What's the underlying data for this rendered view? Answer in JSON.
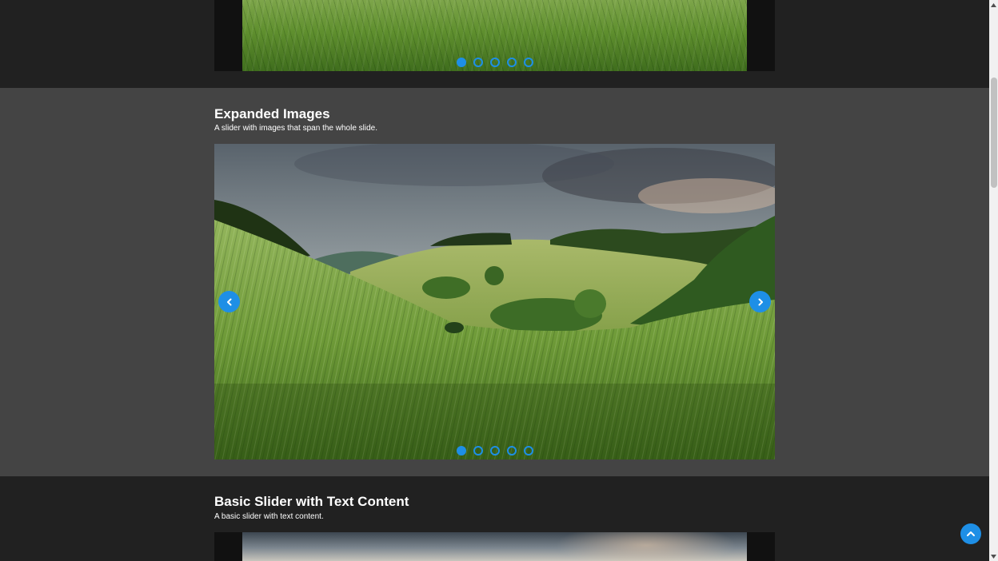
{
  "sections": [
    {
      "id": "previous-slider",
      "active_dot": 0,
      "dot_count": 5
    },
    {
      "id": "expanded-images",
      "title": "Expanded Images",
      "subtitle": "A slider with images that span the whole slide.",
      "active_dot": 0,
      "dot_count": 5,
      "prev_icon": "chevron-left-icon",
      "next_icon": "chevron-right-icon"
    },
    {
      "id": "basic-slider-text",
      "title": "Basic Slider with Text Content",
      "subtitle": "A basic slider with text content."
    }
  ],
  "colors": {
    "accent": "#1e8fe6",
    "dark_bg": "#212121",
    "mid_bg": "#444444"
  },
  "back_to_top_icon": "chevron-up-icon"
}
